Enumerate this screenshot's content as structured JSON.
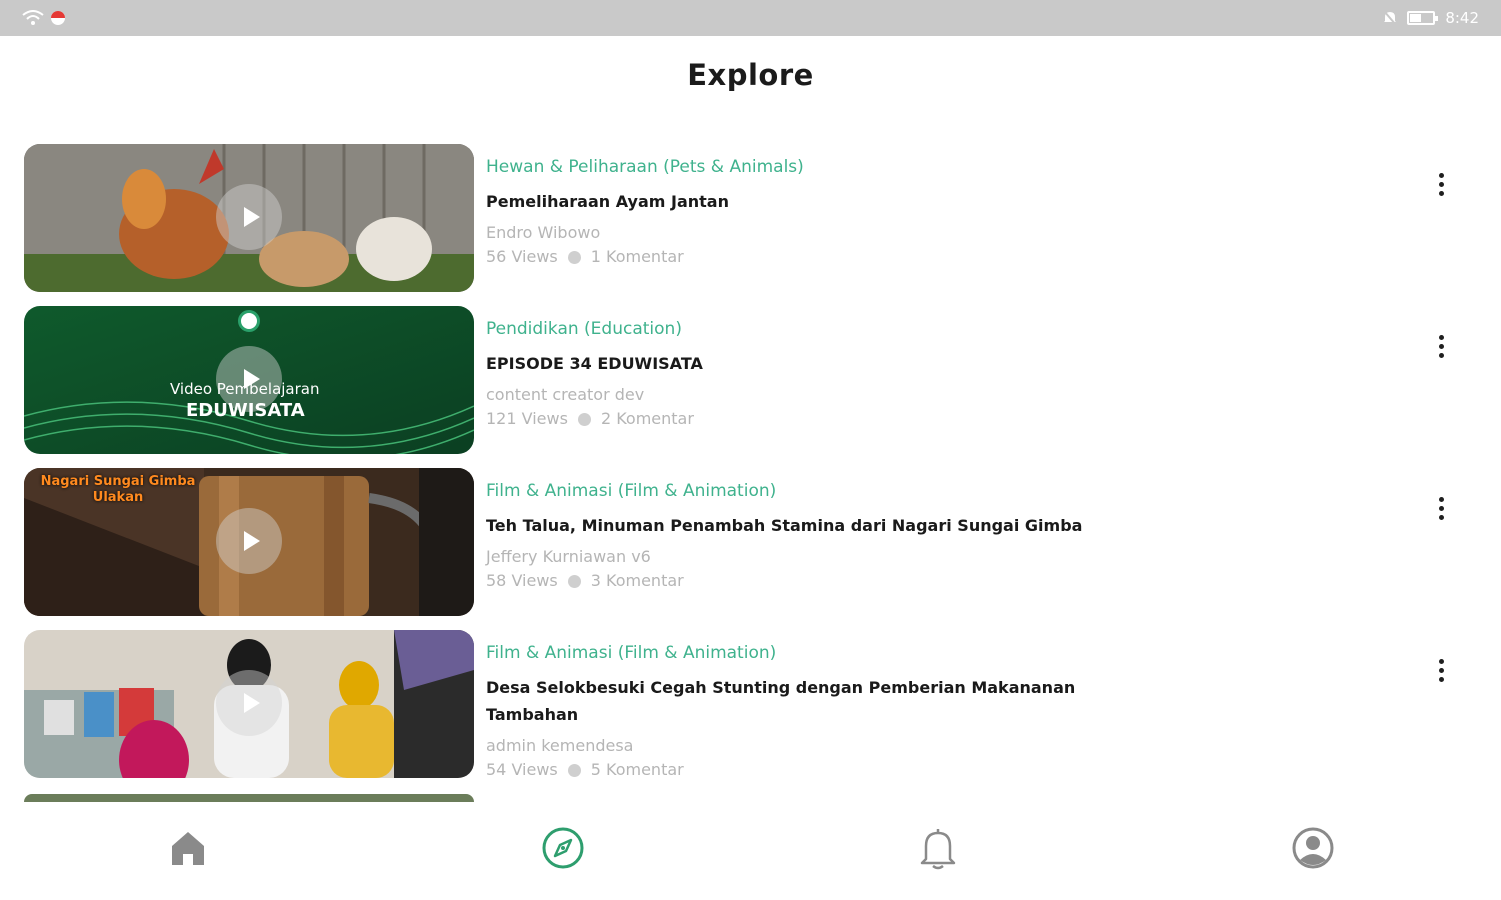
{
  "status_bar": {
    "time": "8:42"
  },
  "header": {
    "title": "Explore"
  },
  "colors": {
    "accent": "#3fb28d",
    "nav_active": "#2e9e6e",
    "nav_inactive": "#8a8a8a"
  },
  "videos": [
    {
      "category": "Hewan & Peliharaan (Pets & Animals)",
      "title": "Pemeliharaan Ayam Jantan",
      "author": "Endro Wibowo",
      "views": "56 Views",
      "comments": "1 Komentar"
    },
    {
      "category": "Pendidikan (Education)",
      "title": "EPISODE 34 EDUWISATA",
      "author": "content creator dev",
      "views": "121 Views",
      "comments": "2 Komentar",
      "thumb_caption_small": "Video Pembelajaran",
      "thumb_caption_large": "EDUWISATA"
    },
    {
      "category": "Film & Animasi (Film & Animation)",
      "title": "Teh Talua, Minuman Penambah Stamina dari Nagari Sungai Gimba",
      "author": "Jeffery Kurniawan v6",
      "views": "58 Views",
      "comments": "3 Komentar",
      "thumb_overlay": "Nagari Sungai Gimba Ulakan"
    },
    {
      "category": "Film & Animasi (Film & Animation)",
      "title": "Desa Selokbesuki Cegah Stunting dengan Pemberian Makananan Tambahan",
      "author": "admin kemendesa",
      "views": "54 Views",
      "comments": "5 Komentar"
    }
  ],
  "bottom_nav": [
    {
      "name": "home",
      "icon": "home-icon"
    },
    {
      "name": "explore",
      "icon": "compass-icon",
      "active": true
    },
    {
      "name": "notifications",
      "icon": "bell-icon"
    },
    {
      "name": "profile",
      "icon": "profile-icon"
    }
  ]
}
